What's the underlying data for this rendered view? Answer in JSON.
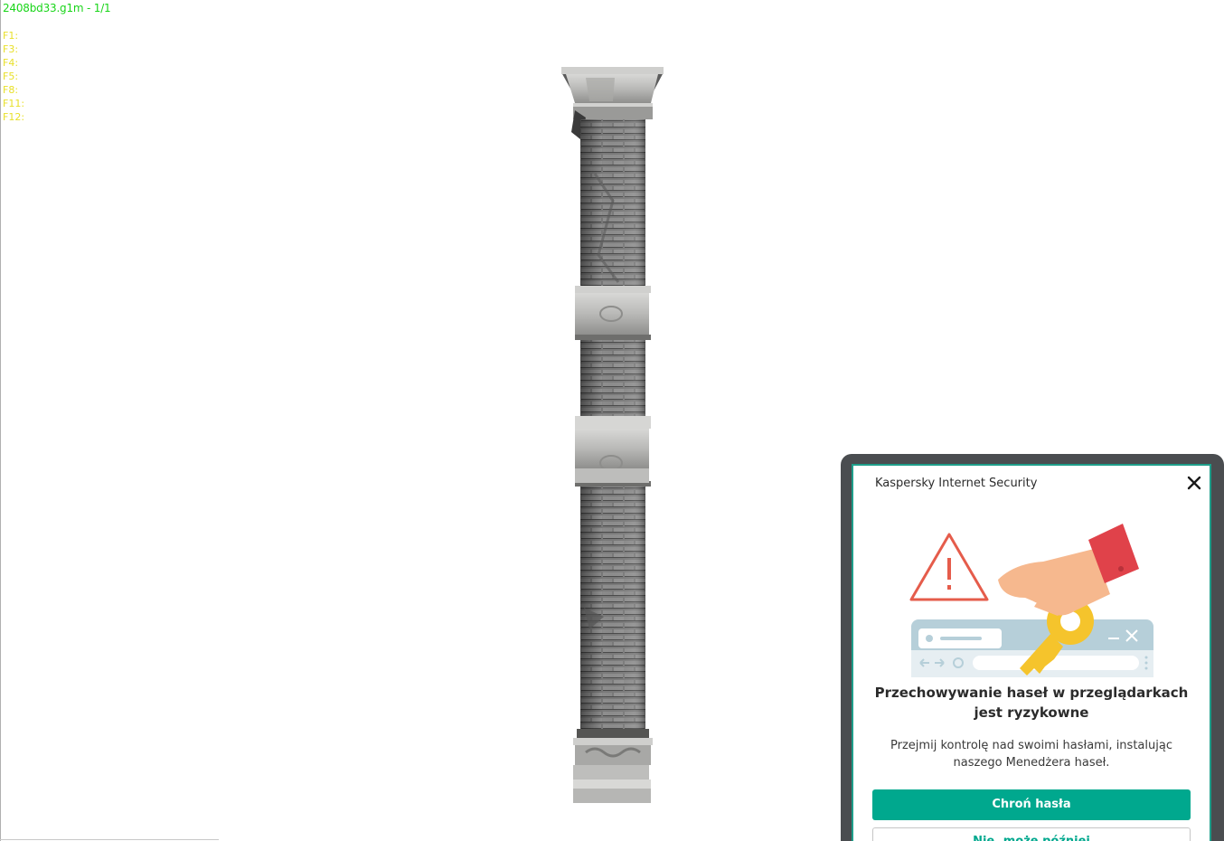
{
  "viewer": {
    "file_label": "2408bd33.g1m - 1/1",
    "function_keys": [
      "F1:",
      "F3:",
      "F4:",
      "F5:",
      "F8:",
      "F11:",
      "F12:"
    ]
  },
  "popup": {
    "title": "Kaspersky Internet Security",
    "headline": "Przechowywanie haseł w przeglądarkach jest ryzykowne",
    "body": "Przejmij kontrolę nad swoimi hasłami, instalując naszego Menedżera haseł.",
    "primary_button": "Chroń hasła",
    "secondary_button": "Nie, może później"
  },
  "colors": {
    "accent": "#00a88e",
    "hud_title": "#19d519",
    "hud_keys": "#e8e02a",
    "warning": "#e55c4b"
  }
}
